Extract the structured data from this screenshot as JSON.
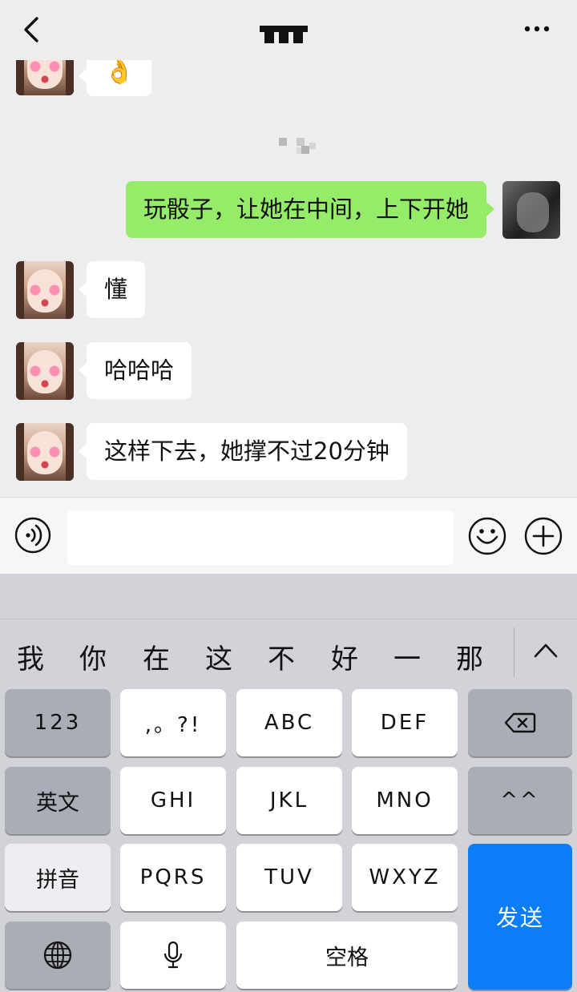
{
  "header": {
    "back_icon": "chevron-left-icon",
    "title_redacted": true,
    "more_icon": "more-dots-icon"
  },
  "messages": [
    {
      "side": "left",
      "text": "👌"
    },
    {
      "side": "right",
      "text": "玩骰子，让她在中间，上下开她"
    },
    {
      "side": "left",
      "text": "懂"
    },
    {
      "side": "left",
      "text": "哈哈哈"
    },
    {
      "side": "left",
      "text": "这样下去，她撑不过20分钟"
    }
  ],
  "input": {
    "voice_icon": "voice-icon",
    "emoji_icon": "emoji-icon",
    "plus_icon": "plus-icon"
  },
  "keyboard": {
    "candidates": [
      "我",
      "你",
      "在",
      "这",
      "不",
      "好",
      "一",
      "那"
    ],
    "keys": {
      "num": "123",
      "punct": ",。?!",
      "abc": "ABC",
      "def": "DEF",
      "english": "英文",
      "ghi": "GHI",
      "jkl": "JKL",
      "mno": "MNO",
      "face": "^^",
      "pinyin": "拼音",
      "pqrs": "PQRS",
      "tuv": "TUV",
      "wxyz": "WXYZ",
      "send": "发送",
      "space": "空格"
    },
    "colors": {
      "send": "#0a7df7",
      "bubble_self": "#95ec69"
    }
  }
}
